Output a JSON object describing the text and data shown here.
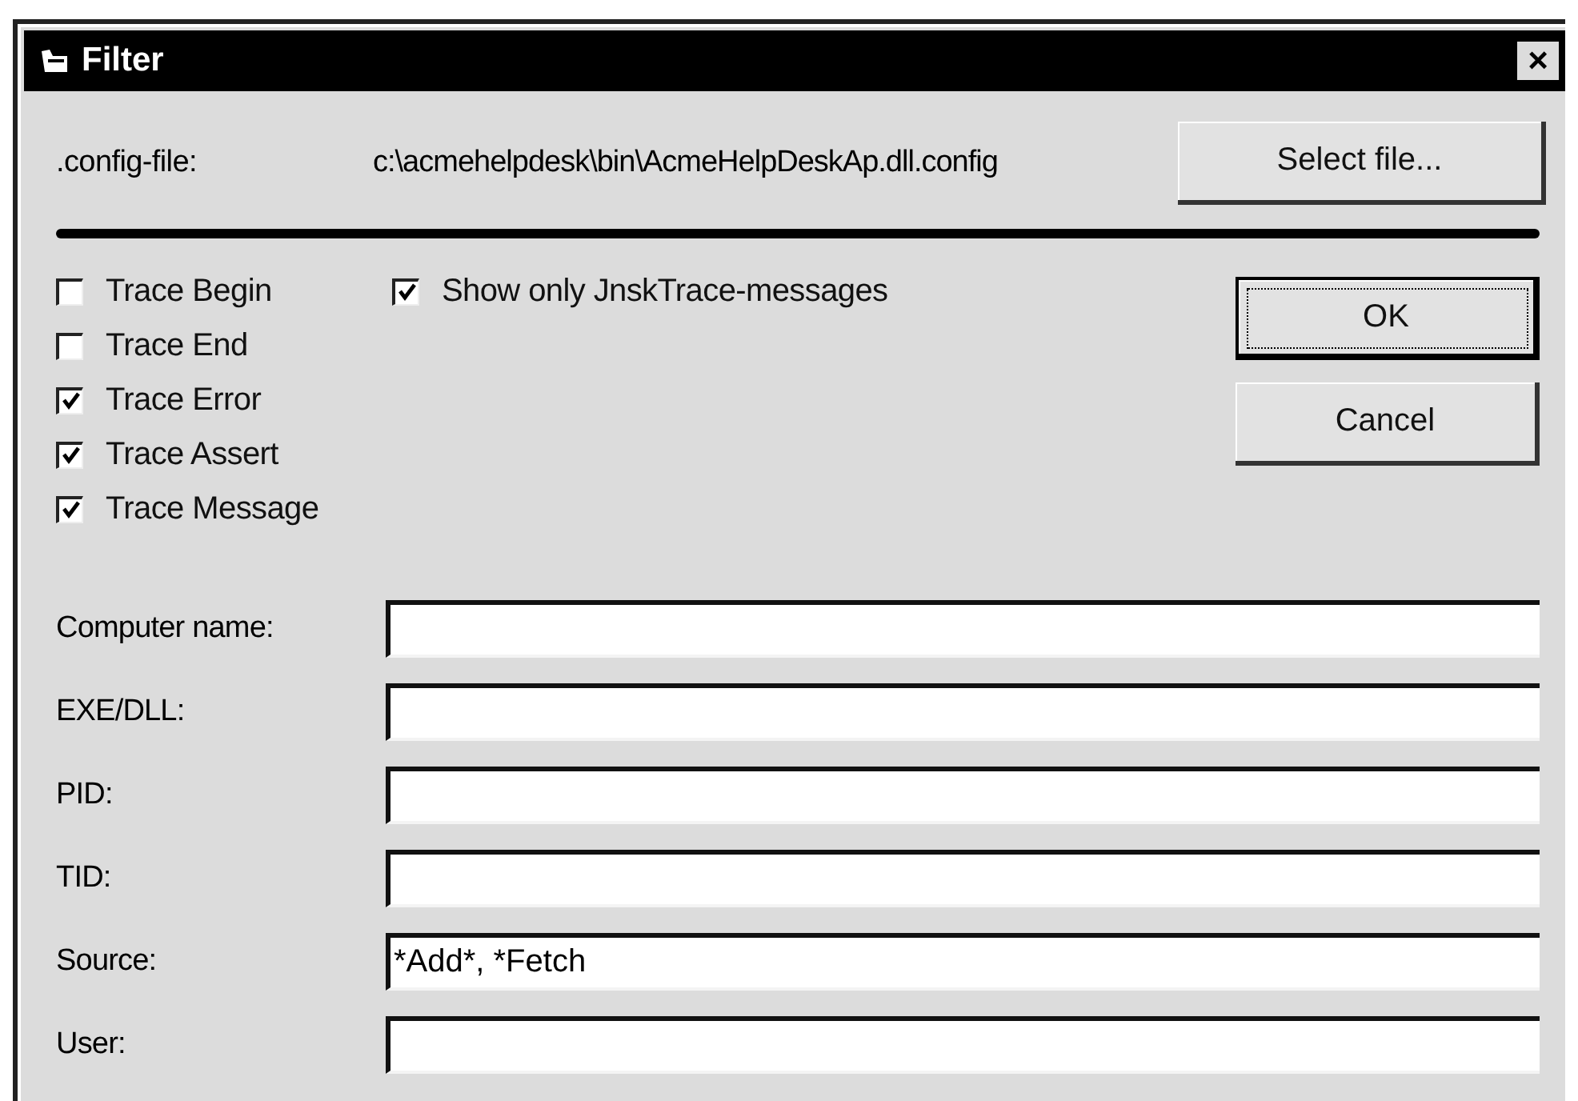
{
  "window": {
    "title": "Filter",
    "close": "×"
  },
  "config": {
    "label": ".config-file:",
    "path": "c:\\acmehelpdesk\\bin\\AcmeHelpDeskAp.dll.config",
    "button": "Select file..."
  },
  "checks": [
    {
      "label": "Trace Begin",
      "checked": false
    },
    {
      "label": "Trace End",
      "checked": false
    },
    {
      "label": "Trace Error",
      "checked": true
    },
    {
      "label": "Trace Assert",
      "checked": true
    },
    {
      "label": "Trace Message",
      "checked": true
    }
  ],
  "show_only": {
    "label": "Show only JnskTrace-messages",
    "checked": true
  },
  "buttons": [
    {
      "label": "OK",
      "default": true
    },
    {
      "label": "Cancel",
      "default": false
    }
  ],
  "fields": [
    {
      "label": "Computer name:"
    },
    {
      "label": "EXE/DLL:"
    },
    {
      "label": "PID:"
    },
    {
      "label": "TID:"
    },
    {
      "label": "Source:",
      "value": "*Add*, *Fetch"
    },
    {
      "label": "User:"
    }
  ]
}
